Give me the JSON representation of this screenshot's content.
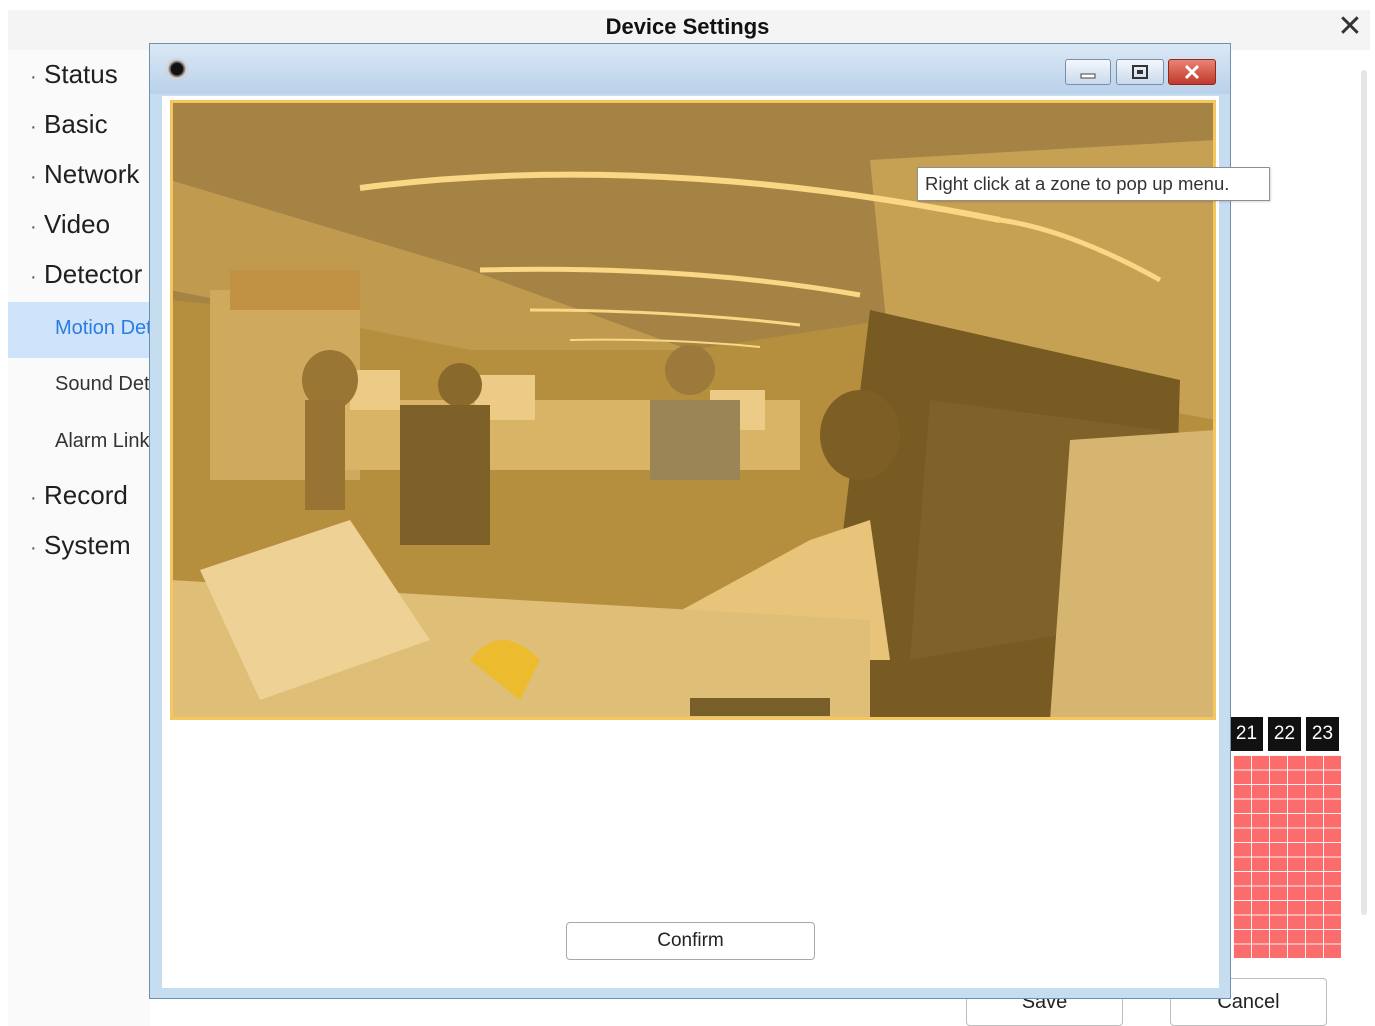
{
  "app": {
    "title": "Device Settings"
  },
  "sidebar": {
    "items": [
      {
        "label": "Status"
      },
      {
        "label": "Basic"
      },
      {
        "label": "Network"
      },
      {
        "label": "Video"
      },
      {
        "label": "Detector"
      },
      {
        "label": "Record"
      },
      {
        "label": "System"
      }
    ],
    "detector_sub": [
      {
        "label": "Motion Detection",
        "active": true
      },
      {
        "label": "Sound Detection"
      },
      {
        "label": "Alarm Linkage"
      }
    ]
  },
  "schedule": {
    "hours": [
      "21",
      "22",
      "23"
    ],
    "active_color": "#fb6c6c"
  },
  "actions": {
    "save_label": "Save",
    "cancel_label": "Cancel"
  },
  "popup": {
    "tooltip": "Right click at a zone to pop up menu.",
    "confirm_label": "Confirm",
    "overlay_color": "#f0b234",
    "icons": [
      "camera-icon",
      "minimize-icon",
      "restore-icon",
      "close-icon"
    ]
  }
}
